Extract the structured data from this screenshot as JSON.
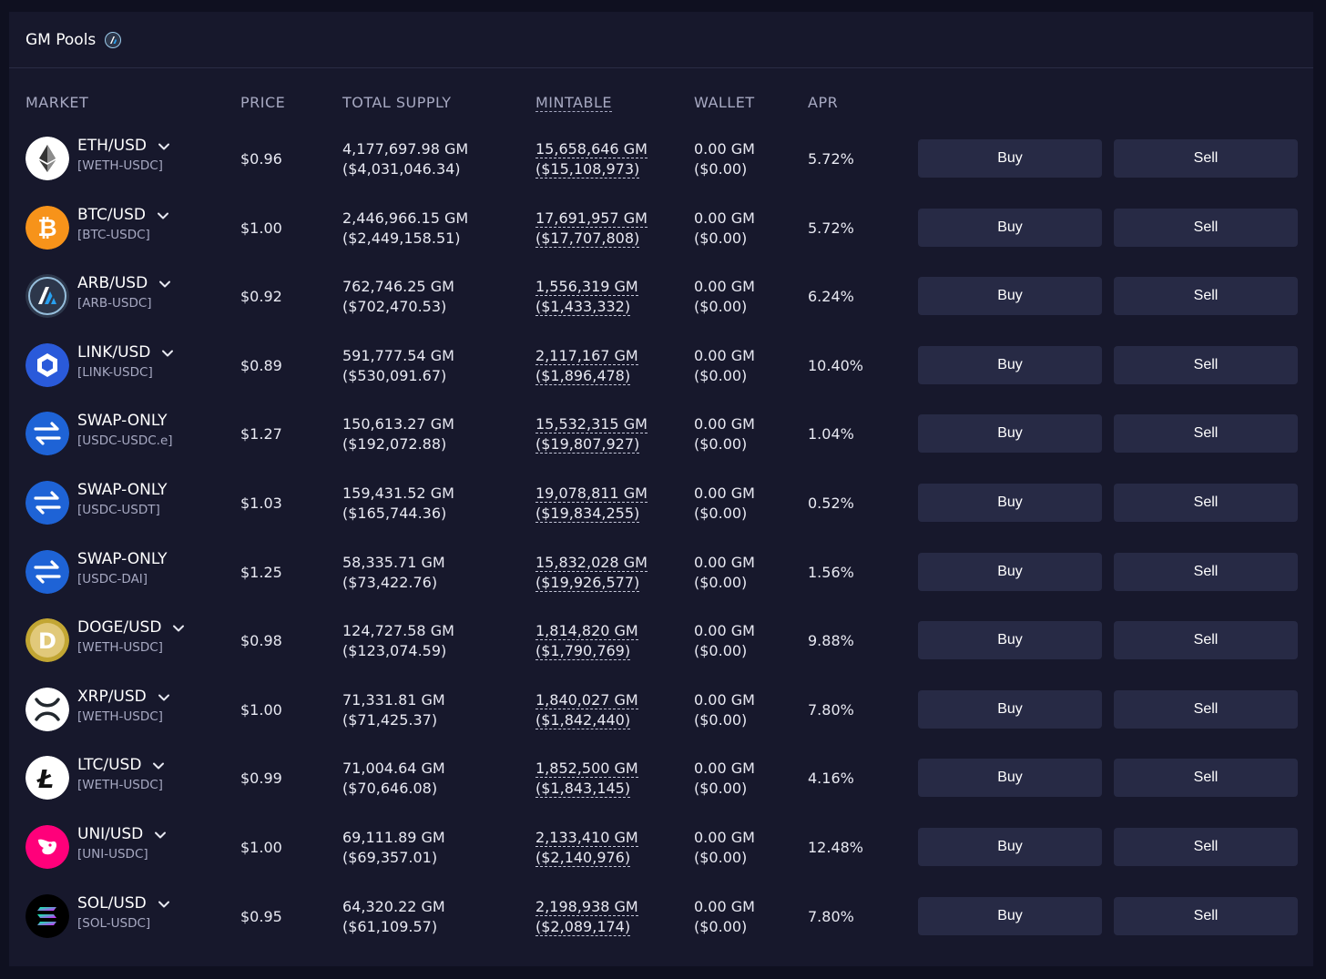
{
  "header": {
    "title": "GM Pools"
  },
  "columns": {
    "market": "MARKET",
    "price": "PRICE",
    "total_supply": "TOTAL SUPPLY",
    "mintable": "MINTABLE",
    "wallet": "WALLET",
    "apr": "APR"
  },
  "buttons": {
    "buy": "Buy",
    "sell": "Sell"
  },
  "rows": [
    {
      "name": "ETH/USD",
      "pair": "[WETH-USDC]",
      "icon": "eth-icon",
      "color": "#ffffff",
      "price": "$0.96",
      "supply": "4,177,697.98 GM",
      "supply_usd": "($4,031,046.34)",
      "mint": "15,658,646 GM",
      "mint_usd": "($15,108,973)",
      "wallet": "0.00 GM",
      "wallet_usd": "($0.00)",
      "apr": "5.72%",
      "dropdown": true
    },
    {
      "name": "BTC/USD",
      "pair": "[BTC-USDC]",
      "icon": "btc-icon",
      "color": "#f7931a",
      "price": "$1.00",
      "supply": "2,446,966.15 GM",
      "supply_usd": "($2,449,158.51)",
      "mint": "17,691,957 GM",
      "mint_usd": "($17,707,808)",
      "wallet": "0.00 GM",
      "wallet_usd": "($0.00)",
      "apr": "5.72%",
      "dropdown": true
    },
    {
      "name": "ARB/USD",
      "pair": "[ARB-USDC]",
      "icon": "arb-icon",
      "color": "#2d374b",
      "price": "$0.92",
      "supply": "762,746.25 GM",
      "supply_usd": "($702,470.53)",
      "mint": "1,556,319 GM",
      "mint_usd": "($1,433,332)",
      "wallet": "0.00 GM",
      "wallet_usd": "($0.00)",
      "apr": "6.24%",
      "dropdown": true
    },
    {
      "name": "LINK/USD",
      "pair": "[LINK-USDC]",
      "icon": "link-icon",
      "color": "#2a5ada",
      "price": "$0.89",
      "supply": "591,777.54 GM",
      "supply_usd": "($530,091.67)",
      "mint": "2,117,167 GM",
      "mint_usd": "($1,896,478)",
      "wallet": "0.00 GM",
      "wallet_usd": "($0.00)",
      "apr": "10.40%",
      "dropdown": true
    },
    {
      "name": "SWAP-ONLY",
      "pair": "[USDC-USDC.e]",
      "icon": "swap-icon",
      "color": "#1e63d6",
      "price": "$1.27",
      "supply": "150,613.27 GM",
      "supply_usd": "($192,072.88)",
      "mint": "15,532,315 GM",
      "mint_usd": "($19,807,927)",
      "wallet": "0.00 GM",
      "wallet_usd": "($0.00)",
      "apr": "1.04%",
      "dropdown": false
    },
    {
      "name": "SWAP-ONLY",
      "pair": "[USDC-USDT]",
      "icon": "swap-icon",
      "color": "#1e63d6",
      "price": "$1.03",
      "supply": "159,431.52 GM",
      "supply_usd": "($165,744.36)",
      "mint": "19,078,811 GM",
      "mint_usd": "($19,834,255)",
      "wallet": "0.00 GM",
      "wallet_usd": "($0.00)",
      "apr": "0.52%",
      "dropdown": false
    },
    {
      "name": "SWAP-ONLY",
      "pair": "[USDC-DAI]",
      "icon": "swap-icon",
      "color": "#1e63d6",
      "price": "$1.25",
      "supply": "58,335.71 GM",
      "supply_usd": "($73,422.76)",
      "mint": "15,832,028 GM",
      "mint_usd": "($19,926,577)",
      "wallet": "0.00 GM",
      "wallet_usd": "($0.00)",
      "apr": "1.56%",
      "dropdown": false
    },
    {
      "name": "DOGE/USD",
      "pair": "[WETH-USDC]",
      "icon": "doge-icon",
      "color": "#c2a633",
      "price": "$0.98",
      "supply": "124,727.58 GM",
      "supply_usd": "($123,074.59)",
      "mint": "1,814,820 GM",
      "mint_usd": "($1,790,769)",
      "wallet": "0.00 GM",
      "wallet_usd": "($0.00)",
      "apr": "9.88%",
      "dropdown": true
    },
    {
      "name": "XRP/USD",
      "pair": "[WETH-USDC]",
      "icon": "xrp-icon",
      "color": "#ffffff",
      "price": "$1.00",
      "supply": "71,331.81 GM",
      "supply_usd": "($71,425.37)",
      "mint": "1,840,027 GM",
      "mint_usd": "($1,842,440)",
      "wallet": "0.00 GM",
      "wallet_usd": "($0.00)",
      "apr": "7.80%",
      "dropdown": true
    },
    {
      "name": "LTC/USD",
      "pair": "[WETH-USDC]",
      "icon": "ltc-icon",
      "color": "#ffffff",
      "price": "$0.99",
      "supply": "71,004.64 GM",
      "supply_usd": "($70,646.08)",
      "mint": "1,852,500 GM",
      "mint_usd": "($1,843,145)",
      "wallet": "0.00 GM",
      "wallet_usd": "($0.00)",
      "apr": "4.16%",
      "dropdown": true
    },
    {
      "name": "UNI/USD",
      "pair": "[UNI-USDC]",
      "icon": "uni-icon",
      "color": "#ff007a",
      "price": "$1.00",
      "supply": "69,111.89 GM",
      "supply_usd": "($69,357.01)",
      "mint": "2,133,410 GM",
      "mint_usd": "($2,140,976)",
      "wallet": "0.00 GM",
      "wallet_usd": "($0.00)",
      "apr": "12.48%",
      "dropdown": true
    },
    {
      "name": "SOL/USD",
      "pair": "[SOL-USDC]",
      "icon": "sol-icon",
      "color": "#000000",
      "price": "$0.95",
      "supply": "64,320.22 GM",
      "supply_usd": "($61,109.57)",
      "mint": "2,198,938 GM",
      "mint_usd": "($2,089,174)",
      "wallet": "0.00 GM",
      "wallet_usd": "($0.00)",
      "apr": "7.80%",
      "dropdown": true
    }
  ]
}
